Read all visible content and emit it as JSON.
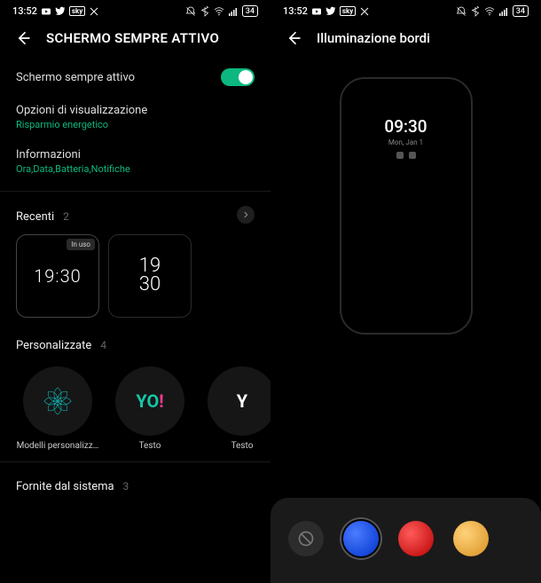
{
  "status": {
    "time": "13:52",
    "battery": "34"
  },
  "screen1": {
    "title": "SCHERMO SEMPRE ATTIVO",
    "toggle_label": "Schermo sempre attivo",
    "display_options": {
      "label": "Opzioni di visualizzazione",
      "sub": "Risparmio energetico"
    },
    "info": {
      "label": "Informazioni",
      "sub": "Ora,Data,Batteria,Notifiche"
    },
    "recents": {
      "label": "Recenti",
      "count": "2",
      "badge_inuse": "In uso",
      "clock1": "19:30",
      "clock2a": "19",
      "clock2b": "30"
    },
    "custom": {
      "label": "Personalizzate",
      "count": "4",
      "items": [
        "Modelli personalizz…",
        "Testo",
        "Testo"
      ]
    },
    "system": {
      "label": "Fornite dal sistema",
      "count": "3"
    }
  },
  "screen2": {
    "title": "Illuminazione bordi",
    "mock": {
      "time": "09:30",
      "date": "Mon, Jan 1"
    }
  }
}
